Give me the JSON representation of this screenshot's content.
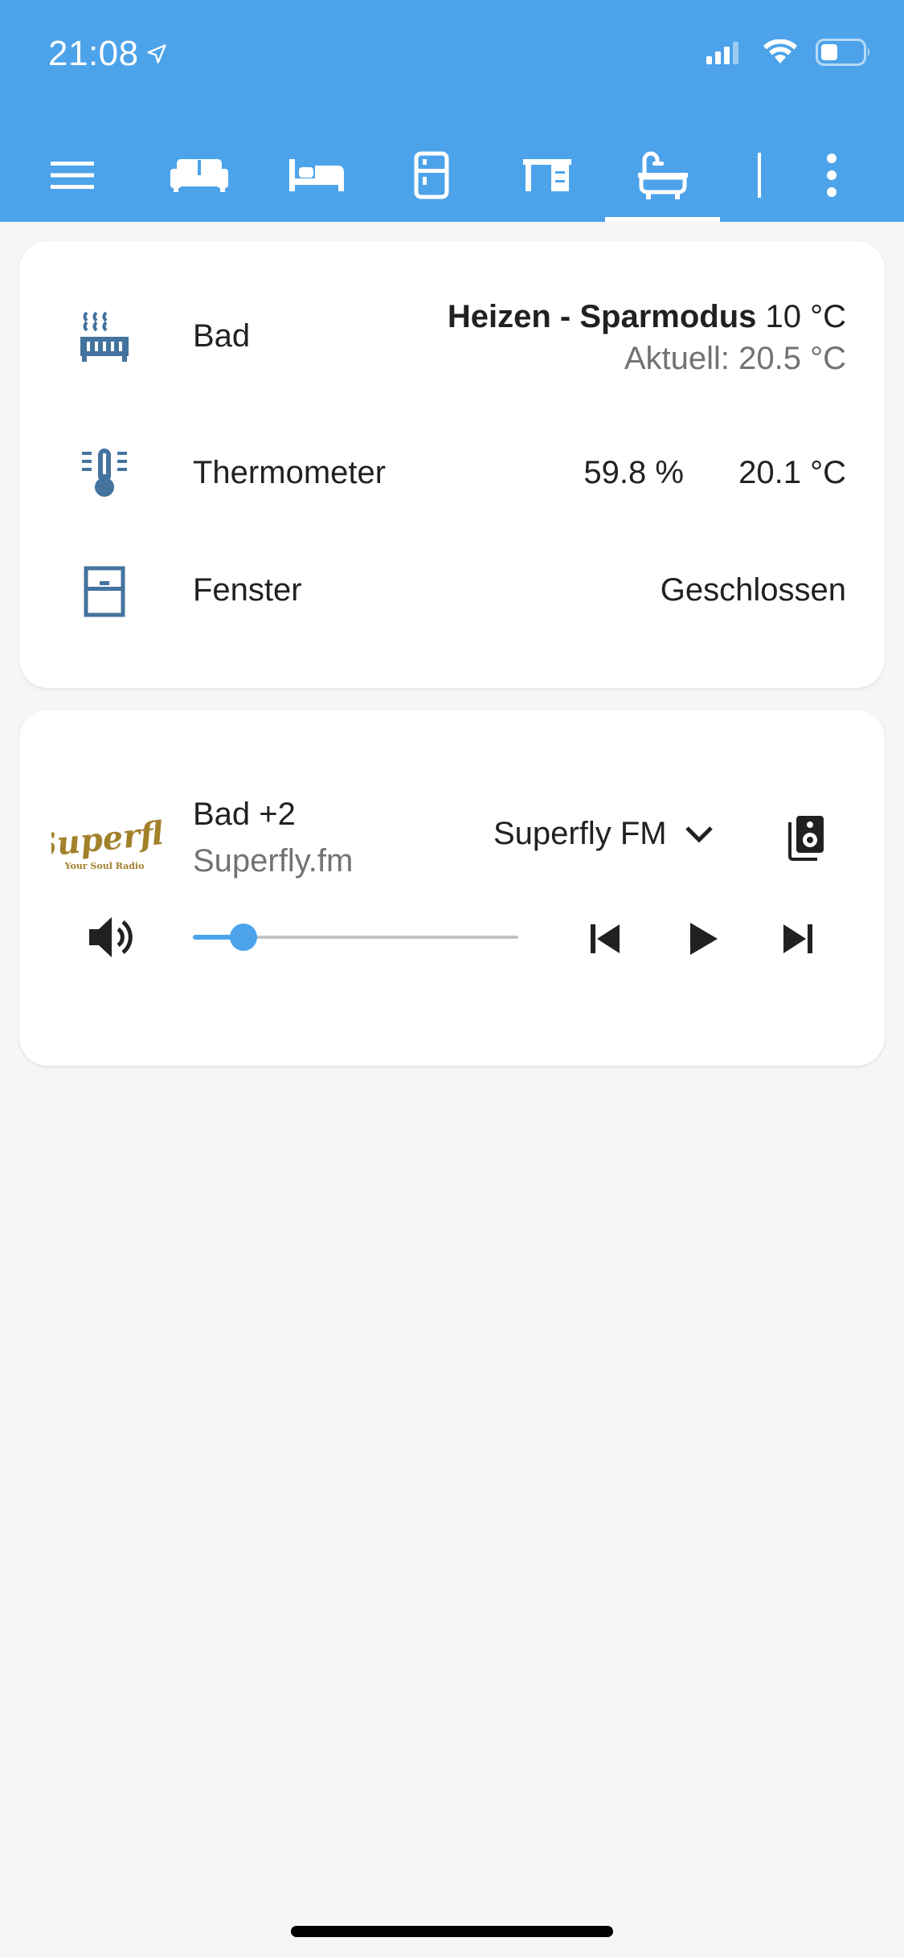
{
  "status_bar": {
    "time": "21:08"
  },
  "toolbar": {
    "icons": [
      "menu-icon",
      "sofa-icon",
      "bed-icon",
      "fridge-icon",
      "desk-icon",
      "bathtub-icon",
      "divider",
      "more-vert-icon"
    ],
    "active_tab": "bathtub-icon"
  },
  "entities": {
    "bad": {
      "name": "Bad",
      "mode_label": "Heizen - Sparmodus",
      "target": "10 °C",
      "current": "Aktuell: 20.5 °C"
    },
    "thermometer": {
      "name": "Thermometer",
      "humidity": "59.8 %",
      "temperature": "20.1 °C"
    },
    "fenster": {
      "name": "Fenster",
      "state": "Geschlossen"
    }
  },
  "media_player": {
    "title": "Bad +2",
    "subtitle": "Superfly.fm",
    "source": "Superfly FM",
    "album_logo_text": "Superfly",
    "album_logo_tagline": "Your Soul Radio",
    "volume_level": 0.12
  },
  "colors": {
    "primary": "#4da3ea",
    "icon": "#44739e",
    "text": "#212121",
    "muted": "#727272",
    "background": "#f6f6f6"
  }
}
